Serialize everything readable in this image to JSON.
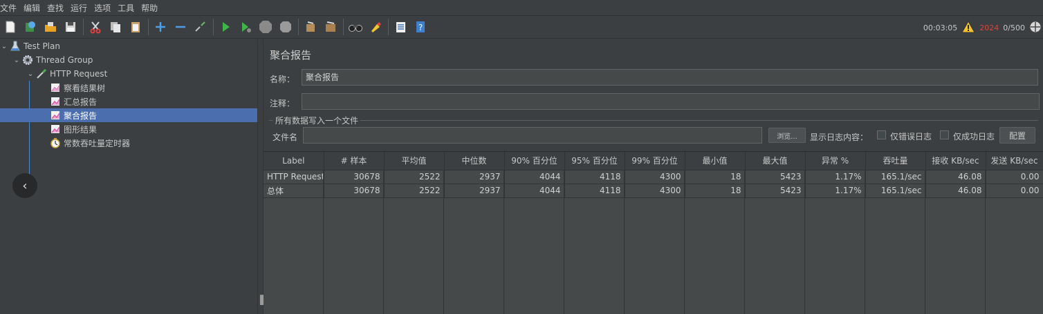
{
  "menu": [
    "文件",
    "编辑",
    "查找",
    "运行",
    "选项",
    "工具",
    "帮助"
  ],
  "toolbar": {
    "elapsed": "00:03:05",
    "error_count": "2024",
    "threads": "0/500",
    "icons": [
      "new-icon",
      "templates-icon",
      "open-icon",
      "save-icon",
      "cut-icon",
      "copy-icon",
      "paste-icon",
      "expand-icon",
      "collapse-icon",
      "toggle-icon",
      "start-icon",
      "start-no-pause-icon",
      "stop-icon",
      "shutdown-icon",
      "clear-icon",
      "clear-all-icon",
      "search-icon",
      "reset-search-icon",
      "function-helper-icon",
      "help-icon"
    ]
  },
  "tree": [
    {
      "label": "Test Plan",
      "icon": "flask-icon"
    },
    {
      "label": "Thread Group",
      "icon": "gear-icon"
    },
    {
      "label": "HTTP Request",
      "icon": "pipette-icon"
    },
    {
      "label": "察看结果树",
      "icon": "chart-icon"
    },
    {
      "label": "汇总报告",
      "icon": "chart-icon"
    },
    {
      "label": "聚合报告",
      "icon": "chart-icon"
    },
    {
      "label": "图形结果",
      "icon": "chart-icon"
    },
    {
      "label": "常数吞吐量定时器",
      "icon": "timer-icon"
    }
  ],
  "panel": {
    "title": "聚合报告",
    "name_label": "名称：",
    "name_value": "聚合报告",
    "comment_label": "注释：",
    "comment_value": "",
    "group_title": "所有数据写入一个文件",
    "file_label": "文件名",
    "file_value": "",
    "browse_label": "浏览...",
    "log_label": "显示日志内容：",
    "errors_only_label": "仅错误日志",
    "success_only_label": "仅成功日志",
    "config_label": "配置"
  },
  "table": {
    "headers": [
      "Label",
      "# 样本",
      "平均值",
      "中位数",
      "90% 百分位",
      "95% 百分位",
      "99% 百分位",
      "最小值",
      "最大值",
      "异常 %",
      "吞吐量",
      "接收 KB/sec",
      "发送 KB/sec"
    ],
    "rows": [
      [
        "HTTP Request",
        "30678",
        "2522",
        "2937",
        "4044",
        "4118",
        "4300",
        "18",
        "5423",
        "1.17%",
        "165.1/sec",
        "46.08",
        "0.00"
      ],
      [
        "总体",
        "30678",
        "2522",
        "2937",
        "4044",
        "4118",
        "4300",
        "18",
        "5423",
        "1.17%",
        "165.1/sec",
        "46.08",
        "0.00"
      ]
    ]
  }
}
